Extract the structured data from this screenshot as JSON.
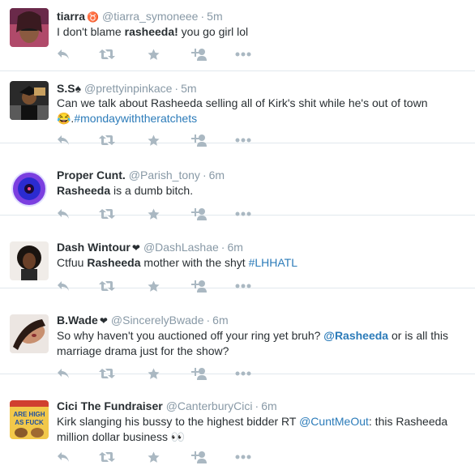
{
  "colors": {
    "link": "#2b7bb9",
    "muted": "#8899a6",
    "text": "#292f33",
    "divider": "#e1e8ed",
    "icon": "#aab8c2"
  },
  "icons": [
    "reply-icon",
    "retweet-icon",
    "favorite-icon",
    "follow-icon",
    "more-icon"
  ],
  "tweets": [
    {
      "fullname": "tiarra",
      "badge": "♉",
      "handle": "@tiarra_symoneee",
      "sep": "·",
      "time": "5m",
      "segments": [
        {
          "t": "I don't blame ",
          "s": "plain"
        },
        {
          "t": "rasheeda!",
          "s": "bold"
        },
        {
          "t": " you go girl lol",
          "s": "plain"
        }
      ]
    },
    {
      "fullname": "S.S♠",
      "badge": "",
      "handle": "@prettyinpinkace",
      "sep": "·",
      "time": "5m",
      "segments": [
        {
          "t": "Can we talk about Rasheeda selling all of Kirk's shit while he's out of town 😂.",
          "s": "plain"
        },
        {
          "t": "#mondaywiththeratchets",
          "s": "link"
        }
      ]
    },
    {
      "fullname": "Proper Cunt.",
      "badge": "",
      "handle": "@Parish_tony",
      "sep": "·",
      "time": "6m",
      "segments": [
        {
          "t": "Rasheeda",
          "s": "bold"
        },
        {
          "t": " is a dumb bitch.",
          "s": "plain"
        }
      ]
    },
    {
      "fullname": "Dash Wintour",
      "badge": "❤",
      "handle": "@DashLashae",
      "sep": "·",
      "time": "6m",
      "segments": [
        {
          "t": "Ctfuu ",
          "s": "plain"
        },
        {
          "t": "Rasheeda",
          "s": "bold"
        },
        {
          "t": " mother with the shyt ",
          "s": "plain"
        },
        {
          "t": "#LHHATL",
          "s": "link"
        }
      ]
    },
    {
      "fullname": "B.Wade",
      "badge": "❤",
      "handle": "@SincerelyBwade",
      "sep": "·",
      "time": "6m",
      "segments": [
        {
          "t": "So why haven't you auctioned off your ring yet bruh? ",
          "s": "plain"
        },
        {
          "t": "@Rasheeda",
          "s": "boldlink"
        },
        {
          "t": " or is all this marriage drama just for the show?",
          "s": "plain"
        }
      ]
    },
    {
      "fullname": "Cici The Fundraiser",
      "badge": "",
      "handle": "@CanterburyCici",
      "sep": "·",
      "time": "6m",
      "avatar_text": "ARE HIGH AS FUCK",
      "segments": [
        {
          "t": "Kirk slanging his bussy to the highest bidder RT ",
          "s": "plain"
        },
        {
          "t": "@CuntMeOut",
          "s": "link"
        },
        {
          "t": ": this Rasheeda million dollar business 👀",
          "s": "plain"
        }
      ]
    }
  ]
}
